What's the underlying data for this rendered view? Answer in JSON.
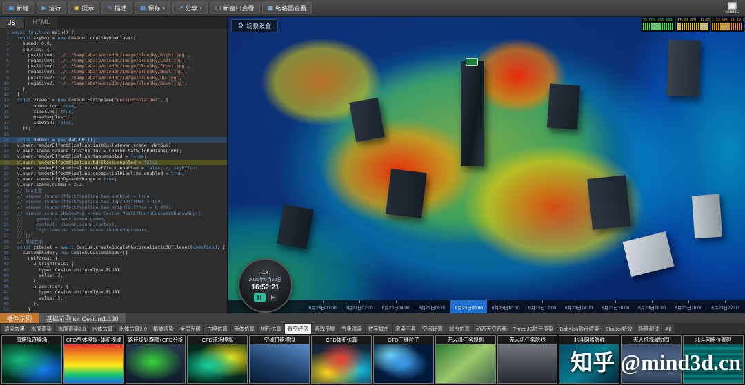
{
  "window": {
    "logo": "Mind3D"
  },
  "toolbar": {
    "items": [
      {
        "label": "新建",
        "icon": "new-file-icon",
        "glyph": "▣",
        "color": "#5aa7ff"
      },
      {
        "label": "运行",
        "icon": "run-icon",
        "glyph": "▶",
        "color": "#5aa7ff"
      },
      {
        "label": "提示",
        "icon": "hint-icon",
        "glyph": "◉",
        "color": "#ffd24a"
      },
      {
        "label": "描述",
        "icon": "describe-icon",
        "glyph": "✎",
        "color": "#5aa7ff"
      },
      {
        "label": "保存",
        "icon": "save-icon",
        "glyph": "▦",
        "color": "#5aa7ff",
        "dropdown": true
      },
      {
        "label": "分享",
        "icon": "share-icon",
        "glyph": "↗",
        "color": "#5aa7ff",
        "dropdown": true
      },
      {
        "label": "新窗口查看",
        "icon": "new-window-icon",
        "glyph": "▢",
        "color": "#9fd0ff"
      },
      {
        "label": "缩略图查看",
        "icon": "thumbnail-view-icon",
        "glyph": "▦",
        "color": "#9fd0ff"
      }
    ]
  },
  "editor": {
    "tabs": [
      {
        "label": "JS",
        "active": true
      },
      {
        "label": "HTML",
        "active": false
      }
    ],
    "lines": [
      {
        "t": "async function main() {"
      },
      {
        "t": "  const skybox = new Cesium.LocalSkyBoxClass({"
      },
      {
        "t": "    speed: 0.0,"
      },
      {
        "t": "    sources: {"
      },
      {
        "t": "      positiveX: './../SampleData/mind3d/image/blueSky/Right.jpg',"
      },
      {
        "t": "      negativeX: './../SampleData/mind3d/image/blueSky/Left.jpg',"
      },
      {
        "t": "      positiveY: './../SampleData/mind3d/image/blueSky/Front.jpg',"
      },
      {
        "t": "      negativeY: './../SampleData/mind3d/image/blueSky/Back.jpg',"
      },
      {
        "t": "      positiveZ: './../SampleData/mind3d/image/blueSky/Up.jpg',"
      },
      {
        "t": "      negativeZ: './../SampleData/mind3d/image/blueSky/Down.jpg',"
      },
      {
        "t": "    }"
      },
      {
        "t": "  })"
      },
      {
        "t": "  const viewer = new Cesium.EarthView(\"cesiumContainer\", {"
      },
      {
        "t": "        animation: true,"
      },
      {
        "t": "        timeline: true,"
      },
      {
        "t": "        msaaSamples: 1,"
      },
      {
        "t": "        showSSR: false,"
      },
      {
        "t": "    });"
      },
      {
        "t": ""
      },
      {
        "t": "  const datGui = new dat.GUI();",
        "m": "sel"
      },
      {
        "t": "  viewer.renderEffectPipeline.initGui(viewer.scene, datGui);"
      },
      {
        "t": "  viewer.scene.camera.frustum.fov = Cesium.Math.toRadians(100);"
      },
      {
        "t": "  viewer.renderEffectPipeline.taa.enabled = false;"
      },
      {
        "t": "  viewer.renderEffectPipeline.hdrBloom.enabled = false",
        "m": "hl"
      },
      {
        "t": "  viewer.renderEffectPipeline.skyEffect.enabled = false; // skyEffect"
      },
      {
        "t": "  viewer.renderEffectPipeline.geospatialPipeline.enabled = true;"
      },
      {
        "t": "  viewer.scene.highDynamicRange = true;"
      },
      {
        "t": "  viewer.scene.gamma = 2.2;"
      },
      {
        "t": "  // taa设置"
      },
      {
        "t": "  // viewer.renderEffectPipeline.taa.enabled = true"
      },
      {
        "t": "  // viewer.renderEffectPipeline.taa.depthDiffMax = 100;"
      },
      {
        "t": "  // viewer.renderEffectPipeline.taa.brightDiffMax = 0.0001;"
      },
      {
        "t": "  // viewer.scene.shadowMap = new Cesium.PostEffectsCascadeShadowMap({"
      },
      {
        "t": "  //     gamma: viewer.scene.gamma,"
      },
      {
        "t": "  //     context: viewer.scene.context,"
      },
      {
        "t": "  //     lightCamera: viewer.scene.shadowMapCamera,"
      },
      {
        "t": "  // })"
      },
      {
        "t": "  // 基础色彩"
      },
      {
        "t": "  const tileset = await Cesium.createGooglePhotorealistic3DTileset(undefined, {"
      },
      {
        "t": "    customShader: new Cesium.CustomShader({"
      },
      {
        "t": "      uniforms: {"
      },
      {
        "t": "        u_brightness: {"
      },
      {
        "t": "          type: Cesium.UniformType.FLOAT,"
      },
      {
        "t": "          value: 2,"
      },
      {
        "t": "        },"
      },
      {
        "t": "        u_contrast: {"
      },
      {
        "t": "          type: Cesium.UniformType.FLOAT,"
      },
      {
        "t": "          value: 2,"
      },
      {
        "t": "        },"
      },
      {
        "t": "      },"
      }
    ]
  },
  "viewport": {
    "scene_settings": "场景设置",
    "stats": [
      {
        "label": "55 FPS (55-100)",
        "color": "#4dff6a"
      },
      {
        "label": "17.00 CPU (17.85-27.85)",
        "color": "#ffe14d"
      },
      {
        "label": "1.53 GPU (1.10-8.05)",
        "color": "#ffb300"
      }
    ],
    "clock": {
      "speed": "1x",
      "date": "2025年6月23日",
      "time": "16:52:21"
    },
    "timeline": {
      "ticks": [
        "6月23日00:00",
        "6月23日02:00",
        "6月23日04:00",
        "6月23日06:00",
        "6月23日08:00",
        "6月23日10:00",
        "6月23日12:00",
        "6月23日14:00",
        "6月23日16:00",
        "6月23日18:00",
        "6月23日20:00",
        "6月23日22:00"
      ],
      "highlight_index": 4
    }
  },
  "bottom": {
    "panel_tabs": [
      {
        "label": "插件示例",
        "active": true
      },
      {
        "label": "基础示例 for Cesium1.130",
        "active": false
      }
    ],
    "categories": [
      {
        "label": "渲染效果"
      },
      {
        "label": "水面渲染"
      },
      {
        "label": "水面渲染2.0"
      },
      {
        "label": "水体仿真"
      },
      {
        "label": "水体仿真2.0"
      },
      {
        "label": "植被渲染"
      },
      {
        "label": "全局光照"
      },
      {
        "label": "白模仿真"
      },
      {
        "label": "流体仿真"
      },
      {
        "label": "地形仿真"
      },
      {
        "label": "低空经济",
        "active": true
      },
      {
        "label": "游戏引擎"
      },
      {
        "label": "气象渲染"
      },
      {
        "label": "数字城市"
      },
      {
        "label": "渲染工具"
      },
      {
        "label": "空间计算"
      },
      {
        "label": "城市仿真"
      },
      {
        "label": "动态天空系统"
      },
      {
        "label": "ThreeJS融合渲染"
      },
      {
        "label": "Babylon融合渲染"
      },
      {
        "label": "Shader特效"
      },
      {
        "label": "场景测试"
      },
      {
        "label": "All"
      }
    ],
    "cards": [
      {
        "title": "风场轨迹绕场"
      },
      {
        "title": "CFD气体模拟+体积视域"
      },
      {
        "title": "路径规划避障+CFD分析"
      },
      {
        "title": "CFD流场模拟"
      },
      {
        "title": "空域日照模拟"
      },
      {
        "title": "CFD体积仿真"
      },
      {
        "title": "CFD三维粒子"
      },
      {
        "title": "无人机任务规划"
      },
      {
        "title": "无人机任务航线"
      },
      {
        "title": "北斗网格航线"
      },
      {
        "title": "无人机视域协同"
      },
      {
        "title": "北斗网格位置码"
      }
    ]
  },
  "watermark": {
    "site": "知乎",
    "handle": "@mind3d.cn"
  }
}
